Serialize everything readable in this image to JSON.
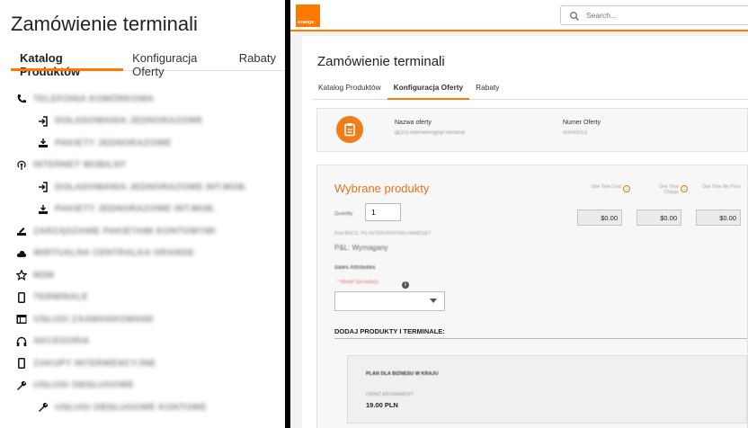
{
  "left": {
    "title": "Zamówienie terminali",
    "tabs": [
      {
        "label": "Katalog Produktów",
        "active": true
      },
      {
        "label": "Konfiguracja Oferty",
        "active": false
      },
      {
        "label": "Rabaty",
        "active": false
      }
    ],
    "catalog": [
      {
        "label": "TELEFONIA KOMÓRKOWA",
        "icon": "phone-icon",
        "level": 0
      },
      {
        "label": "DOŁADOWANIA JEDNORAZOWE",
        "icon": "login-icon",
        "level": 1
      },
      {
        "label": "PAKIETY JEDNORAZOWE",
        "icon": "inbox-download-icon",
        "level": 1
      },
      {
        "label": "INTERNET MOBILNY",
        "icon": "antenna-icon",
        "level": 0
      },
      {
        "label": "DOŁADOWANIA JEDNORAZOWE INT.MOB.",
        "icon": "login-icon",
        "level": 1
      },
      {
        "label": "PAKIETY JEDNORAZOWE INT.MOB.",
        "icon": "inbox-download-icon",
        "level": 1
      },
      {
        "label": "ZARZĄDZANIE PAKIETAMI KONTOWYMI",
        "icon": "inbox-edit-icon",
        "level": 0
      },
      {
        "label": "WIRTUALNA CENTRALKA ORANGE",
        "icon": "cloud-icon",
        "level": 0
      },
      {
        "label": "M2M",
        "icon": "star-icon",
        "level": 0
      },
      {
        "label": "TERMINALE",
        "icon": "mobile-icon",
        "level": 0
      },
      {
        "label": "USŁUGI ZAAWANSOWANE",
        "icon": "table-icon",
        "level": 0
      },
      {
        "label": "AKCESORIA",
        "icon": "headphones-icon",
        "level": 0
      },
      {
        "label": "ZAKUPY INTERWENCYJNE",
        "icon": "mobile-icon",
        "level": 0
      },
      {
        "label": "USŁUGI OBSŁUGOWE",
        "icon": "wrench-icon",
        "level": 0
      },
      {
        "label": "USŁUGI OBSŁUGOWE KONTOWE",
        "icon": "wrench-icon",
        "level": 1
      }
    ]
  },
  "right": {
    "logo": "orange",
    "search_placeholder": "Search...",
    "title": "Zamówienie terminali",
    "tabs": [
      {
        "label": "Katalog Produktów",
        "active": false
      },
      {
        "label": "Konfiguracja Oferty",
        "active": true
      },
      {
        "label": "Rabaty",
        "active": false
      }
    ],
    "offer": {
      "name_label": "Nazwa oferty",
      "name_value": "ql(10)-interwencyjny/Terminal",
      "number_label": "Numer Oferty",
      "number_value": "00000013"
    },
    "products": {
      "title": "Wybrane produkty",
      "quantity_label": "Quantity",
      "quantity_value": "1",
      "columns": [
        {
          "label": "One Time Cost",
          "value": "$0.00"
        },
        {
          "label": "One Time Charge",
          "value": "$0.00"
        },
        {
          "label": "One Time Mn Price",
          "value": "$0.00"
        }
      ],
      "code_line": "Kod BSCS: PS-INTERVENTION-HANDSET",
      "product_name": "P&L: Wymagany",
      "attrs_title": "Sales Attributes",
      "attr_label": "* Model Sprzedaży",
      "add_section": "DODAJ PRODUKTY I TERMINALE:",
      "plan_name": "PLAN DLA BIZNESU W KRAJU",
      "plan_sub": "OBNIŻ ABONAMENT",
      "plan_price": "19.00 PLN"
    }
  },
  "colors": {
    "accent": "#ff7900",
    "section_title": "#e8731a"
  }
}
